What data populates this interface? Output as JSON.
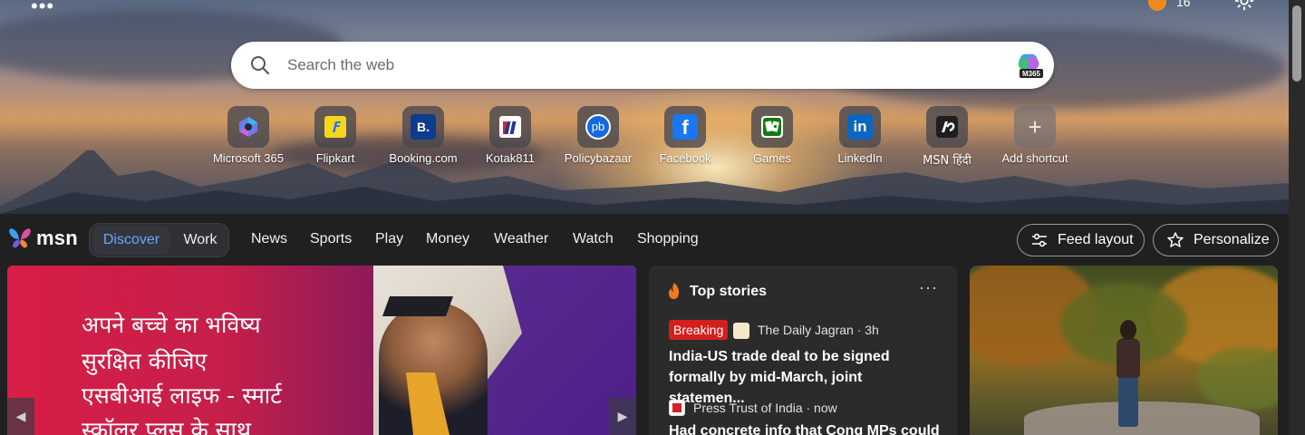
{
  "header": {
    "coins": "16"
  },
  "search": {
    "placeholder": "Search the web",
    "badge": "M365"
  },
  "shortcuts": [
    {
      "label": "Microsoft 365",
      "icon": "microsoft365-icon"
    },
    {
      "label": "Flipkart",
      "icon": "flipkart-icon"
    },
    {
      "label": "Booking.com",
      "icon": "booking-icon",
      "glyph": "B."
    },
    {
      "label": "Kotak811",
      "icon": "kotak-icon"
    },
    {
      "label": "Policybazaar",
      "icon": "policybazaar-icon",
      "glyph": "pb"
    },
    {
      "label": "Facebook",
      "icon": "facebook-icon",
      "glyph": "f"
    },
    {
      "label": "Games",
      "icon": "games-icon"
    },
    {
      "label": "LinkedIn",
      "icon": "linkedin-icon",
      "glyph": "in"
    },
    {
      "label": "MSN हिंदी",
      "icon": "msn-hindi-icon"
    },
    {
      "label": "Add shortcut",
      "icon": "plus-icon",
      "glyph": "+"
    }
  ],
  "nav": {
    "logo": "msn",
    "discover": "Discover",
    "work": "Work",
    "links": [
      "News",
      "Sports",
      "Play",
      "Money",
      "Weather",
      "Watch",
      "Shopping"
    ],
    "feed_layout": "Feed layout",
    "personalize": "Personalize"
  },
  "promo": {
    "lines": [
      "अपने बच्चे का भविष्य",
      "सुरक्षित कीजिए",
      "एसबीआई लाइफ - स्मार्ट",
      "स्कॉलर प्लस के साथ"
    ]
  },
  "top_stories": {
    "title": "Top stories",
    "more": "···",
    "items": [
      {
        "badge": "Breaking",
        "source": "The Daily Jagran · 3h",
        "headline": "India-US trade deal to be signed formally by mid-March, joint statemen..."
      },
      {
        "source": "Press Trust of India · now",
        "headline": "Had concrete info that Cong MPs could"
      }
    ]
  },
  "colors": {
    "accent": "#6ea3ff",
    "breaking": "#d41f1f",
    "coin": "#f08a1e"
  }
}
